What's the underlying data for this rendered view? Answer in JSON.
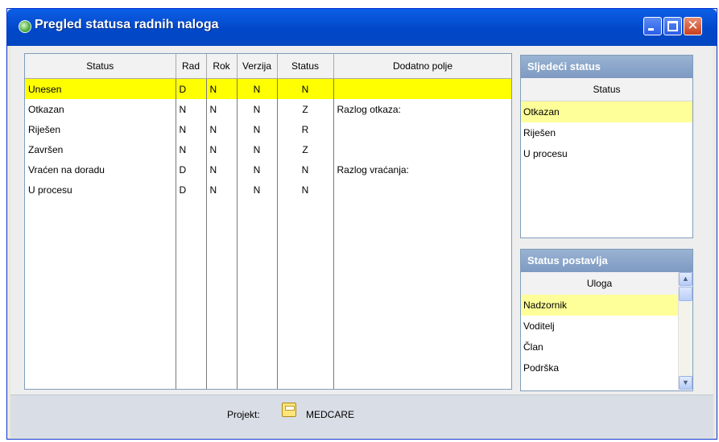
{
  "window": {
    "title": "Pregled statusa radnih naloga",
    "close_glyph": "✕"
  },
  "grid": {
    "columns": [
      "Status",
      "Rad",
      "Rok",
      "Verzija",
      "Status",
      "Dodatno polje"
    ],
    "rows": [
      {
        "status": "Unesen",
        "rad": "D",
        "rok": "N",
        "verzija": "N",
        "code": "N",
        "dodatno": ""
      },
      {
        "status": "Otkazan",
        "rad": "N",
        "rok": "N",
        "verzija": "N",
        "code": "Z",
        "dodatno": "Razlog otkaza:"
      },
      {
        "status": "Riješen",
        "rad": "N",
        "rok": "N",
        "verzija": "N",
        "code": "R",
        "dodatno": ""
      },
      {
        "status": "Završen",
        "rad": "N",
        "rok": "N",
        "verzija": "N",
        "code": "Z",
        "dodatno": ""
      },
      {
        "status": "Vraćen na doradu",
        "rad": "D",
        "rok": "N",
        "verzija": "N",
        "code": "N",
        "dodatno": "Razlog vraćanja:"
      },
      {
        "status": "U procesu",
        "rad": "D",
        "rok": "N",
        "verzija": "N",
        "code": "N",
        "dodatno": ""
      }
    ]
  },
  "next_status": {
    "title": "Sljedeći status",
    "column": "Status",
    "items": [
      "Otkazan",
      "Riješen",
      "U procesu"
    ]
  },
  "set_by": {
    "title": "Status postavlja",
    "column": "Uloga",
    "items": [
      "Nadzornik",
      "Voditelj",
      "Član",
      "Podrška"
    ],
    "scroll_up_glyph": "▲",
    "scroll_down_glyph": "▼"
  },
  "footer": {
    "project_label": "Projekt:",
    "project_value": "MEDCARE"
  }
}
